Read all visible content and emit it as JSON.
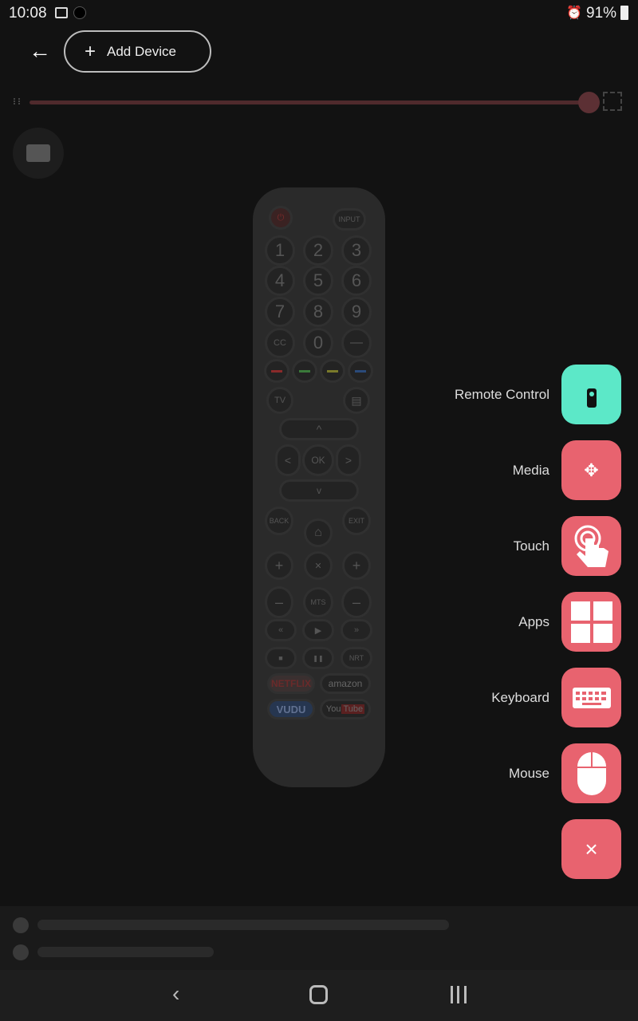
{
  "status_bar": {
    "time": "10:08",
    "battery": "91%",
    "icons": [
      "image-icon",
      "app-notification-icon",
      "alarm-icon",
      "battery-icon"
    ]
  },
  "header": {
    "back_icon": "arrow-left-icon",
    "add_device_label": "Add Device"
  },
  "slider": {
    "value_percent": 100,
    "color": "#5c3034"
  },
  "remote": {
    "power": "⏻",
    "input": "INPUT",
    "digits": [
      "1",
      "2",
      "3",
      "4",
      "5",
      "6",
      "7",
      "8",
      "9"
    ],
    "cc": "CC",
    "zero": "0",
    "dash": "—",
    "colors": [
      "#8a2a2a",
      "#3a7a3a",
      "#7a7a2a",
      "#2a4a7a"
    ],
    "tv": "TV",
    "ok": "OK",
    "up": "^",
    "down": "v",
    "left": "<",
    "right": ">",
    "back": "BACK",
    "exit": "EXIT",
    "home": "⌂",
    "plus": "+",
    "minus": "–",
    "mute": "🔇",
    "mts": "MTS",
    "rewind": "«",
    "play": "▶",
    "ffwd": "»",
    "stop": "■",
    "pause": "❚❚",
    "nrt": "NRT",
    "netflix": "NETFLIX",
    "amazon": "amazon",
    "vudu": "VUDU",
    "youtube_you": "You",
    "youtube_tube": "Tube"
  },
  "menu": {
    "items": [
      {
        "label": "Remote Control",
        "icon": "remote-icon",
        "color": "#5ce8c8"
      },
      {
        "label": "Media",
        "icon": "dpad-icon",
        "color": "#e8636f"
      },
      {
        "label": "Touch",
        "icon": "touch-icon",
        "color": "#e8636f"
      },
      {
        "label": "Apps",
        "icon": "apps-grid-icon",
        "color": "#e8636f"
      },
      {
        "label": "Keyboard",
        "icon": "keyboard-icon",
        "color": "#e8636f"
      },
      {
        "label": "Mouse",
        "icon": "mouse-icon",
        "color": "#e8636f"
      }
    ],
    "close": "×"
  }
}
